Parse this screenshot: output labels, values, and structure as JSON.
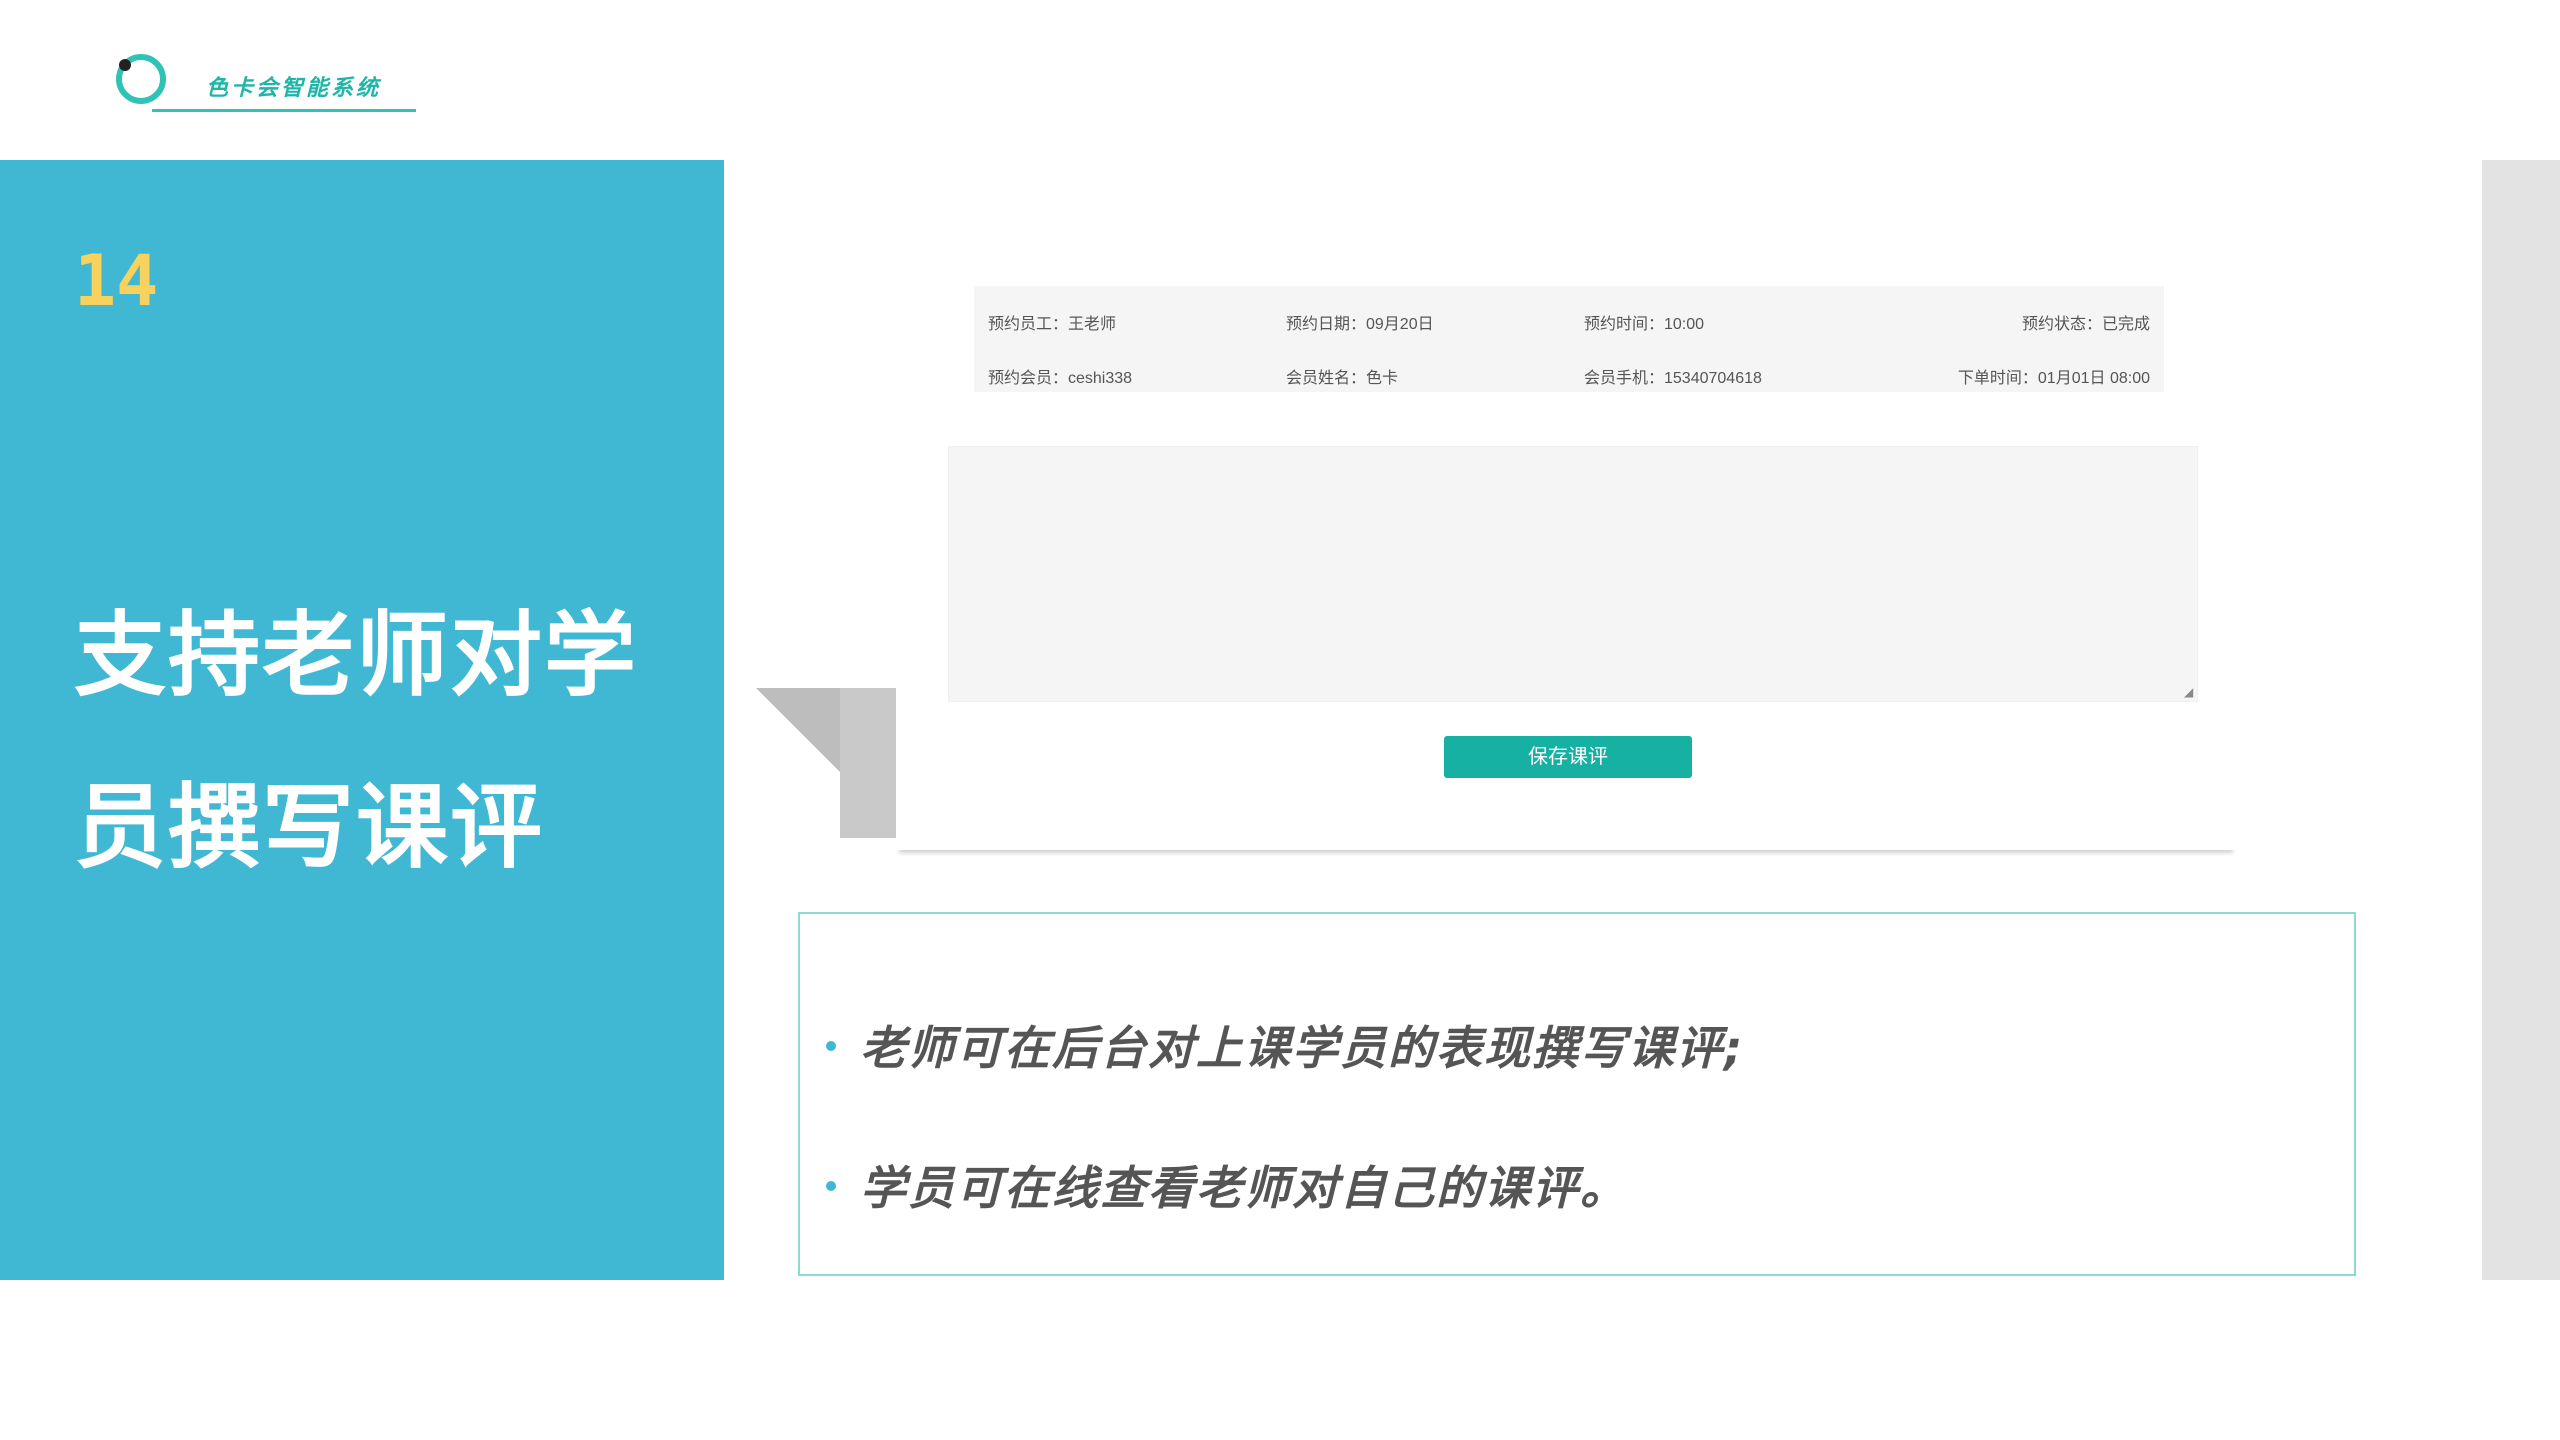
{
  "logo": {
    "text": "色卡会智能系统"
  },
  "slide": {
    "number": "14",
    "title_line1": "支持老师对学",
    "title_line2": "员撰写课评"
  },
  "screenshot": {
    "info_row1": [
      "预约员工：王老师",
      "预约日期：09月20日",
      "预约时间：10:00",
      "预约状态：已完成"
    ],
    "info_row2": [
      "预约会员：ceshi338",
      "会员姓名：色卡",
      "会员手机：15340704618",
      "下单时间：01月01日 08:00"
    ],
    "comment_value": "",
    "save_button": "保存课评"
  },
  "bullets": [
    "老师可在后台对上课学员的表现撰写课评;",
    "学员可在线查看老师对自己的课评。"
  ],
  "colors": {
    "accent_blue": "#41b8d3",
    "number_yellow": "#f7d25c",
    "button_teal": "#17b1a4",
    "logo_teal": "#2fc3b5"
  }
}
